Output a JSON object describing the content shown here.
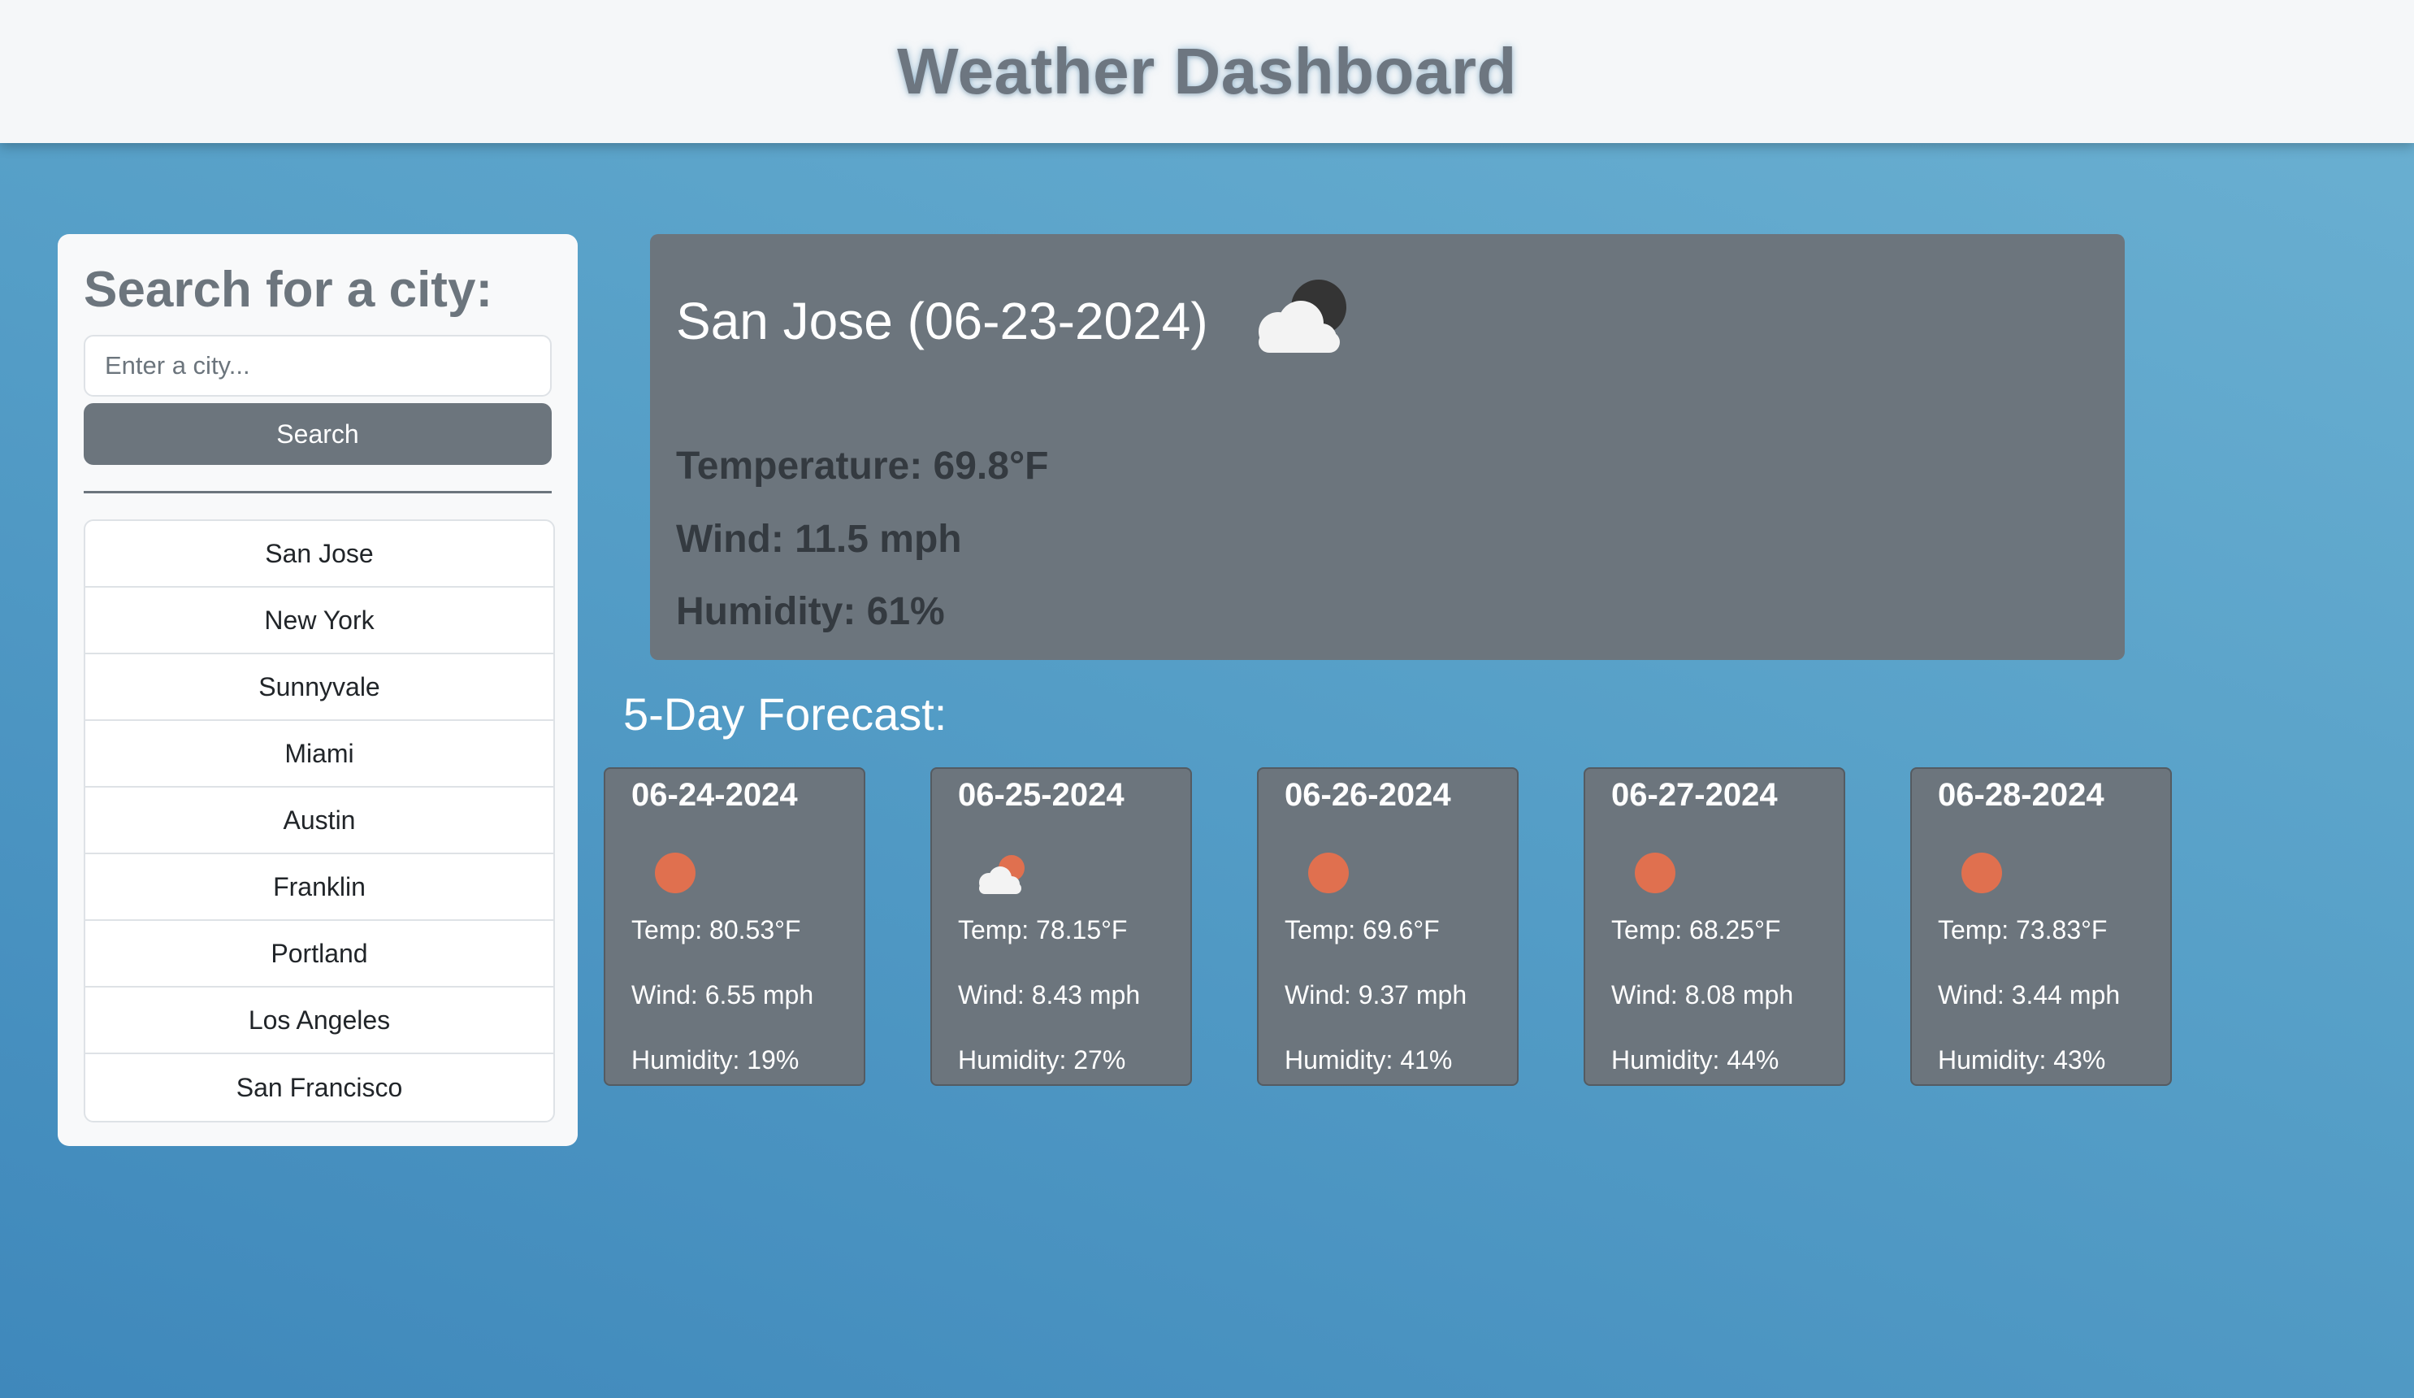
{
  "header": {
    "title": "Weather Dashboard"
  },
  "search": {
    "heading": "Search for a city:",
    "placeholder": "Enter a city...",
    "button_label": "Search"
  },
  "history": [
    "San Jose",
    "New York",
    "Sunnyvale",
    "Miami",
    "Austin",
    "Franklin",
    "Portland",
    "Los Angeles",
    "San Francisco"
  ],
  "current": {
    "title": "San Jose (06-23-2024)",
    "icon": "partly-cloudy-night-icon",
    "temperature": "Temperature: 69.8°F",
    "wind": "Wind: 11.5 mph",
    "humidity": "Humidity: 61%"
  },
  "forecast": {
    "heading": "5-Day Forecast:",
    "days": [
      {
        "date": "06-24-2024",
        "icon": "sun-icon",
        "temp": "Temp: 80.53°F",
        "wind": "Wind: 6.55 mph",
        "humidity": "Humidity: 19%"
      },
      {
        "date": "06-25-2024",
        "icon": "partly-cloudy-day-icon",
        "temp": "Temp: 78.15°F",
        "wind": "Wind: 8.43 mph",
        "humidity": "Humidity: 27%"
      },
      {
        "date": "06-26-2024",
        "icon": "sun-icon",
        "temp": "Temp: 69.6°F",
        "wind": "Wind: 9.37 mph",
        "humidity": "Humidity: 41%"
      },
      {
        "date": "06-27-2024",
        "icon": "sun-icon",
        "temp": "Temp: 68.25°F",
        "wind": "Wind: 8.08 mph",
        "humidity": "Humidity: 44%"
      },
      {
        "date": "06-28-2024",
        "icon": "sun-icon",
        "temp": "Temp: 73.83°F",
        "wind": "Wind: 3.44 mph",
        "humidity": "Humidity: 43%"
      }
    ]
  },
  "colors": {
    "panel": "#6c757d",
    "sun": "#e0704f",
    "cloud": "#f2f2f2",
    "moon": "#333333"
  }
}
